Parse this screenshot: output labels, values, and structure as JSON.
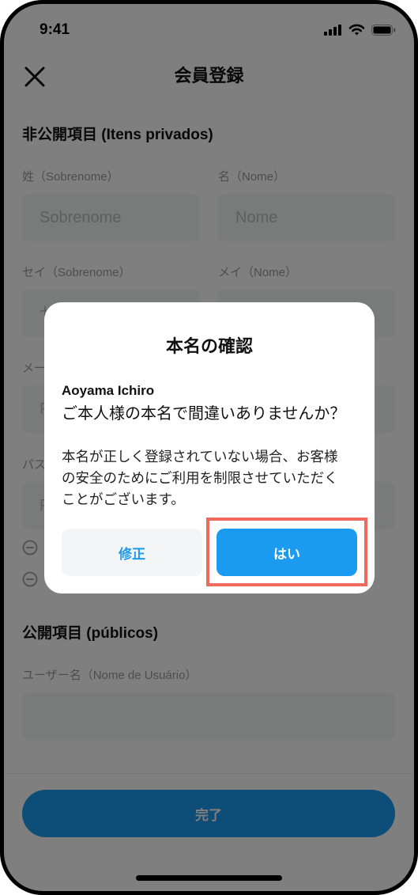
{
  "status_bar": {
    "time": "9:41",
    "icons": [
      "signal-icon",
      "wifi-icon",
      "battery-icon"
    ]
  },
  "header": {
    "title": "会員登録",
    "close_icon": "close-icon"
  },
  "private_section": {
    "title": "非公開項目 (Itens privados)",
    "last_name": {
      "label": "姓（Sobrenome）",
      "placeholder": "Sobrenome"
    },
    "first_name": {
      "label": "名（Nome）",
      "placeholder": "Nome"
    },
    "last_name_kana": {
      "label": "セイ（Sobrenome）",
      "placeholder": "セ"
    },
    "first_name_kana": {
      "label": "メイ（Nome）"
    },
    "mail": {
      "label": "メー",
      "placeholder": "F"
    },
    "password": {
      "label": "パス",
      "placeholder": "P"
    },
    "password_rules": [
      {
        "icon": "minus-circle-icon"
      },
      {
        "icon": "minus-circle-icon"
      }
    ]
  },
  "public_section": {
    "title": "公開項目 (públicos)",
    "username": {
      "label": "ユーザー名（Nome de Usuário）"
    }
  },
  "footer": {
    "submit_label": "完了"
  },
  "dialog": {
    "title": "本名の確認",
    "name": "Aoyama Ichiro",
    "question": "ご本人様の本名で間違いありませんか？",
    "body_lines": [
      "本名が正しく登録されていない場合、お客様",
      "の安全のためにご利用を制限させていただく",
      "ことがございます。"
    ],
    "edit_label": "修正",
    "confirm_label": "はい"
  },
  "colors": {
    "accent": "#1a9bf0",
    "highlight": "#ef6a5b",
    "overlay": "rgba(0,0,0,0.5)"
  }
}
